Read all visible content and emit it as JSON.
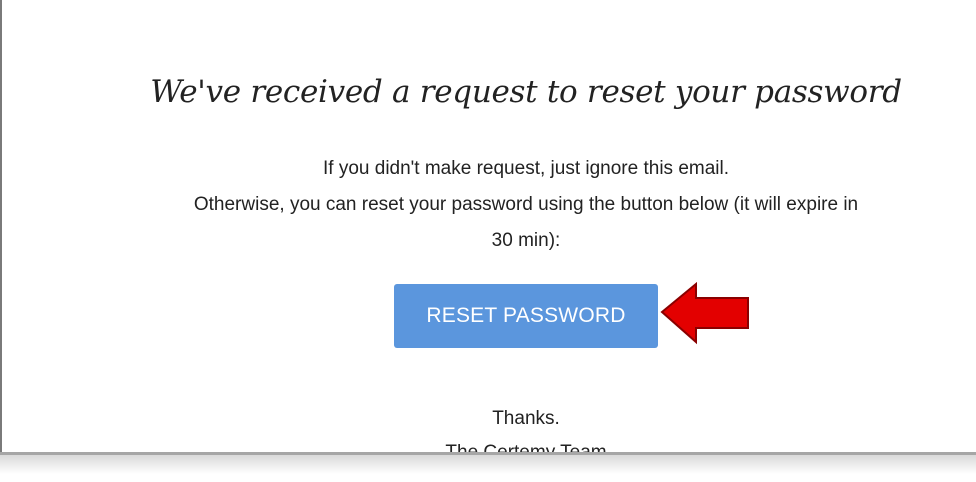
{
  "email": {
    "heading": "We've received a request to reset your password",
    "line1": "If you didn't make request, just ignore this email.",
    "line2": "Otherwise, you can reset your password using the button below (it will expire in",
    "line3": "30 min):",
    "button_label": "RESET PASSWORD",
    "signoff": "Thanks.",
    "signature": "The Certemy Team"
  },
  "colors": {
    "button": "#5b96dd",
    "arrow": "#e30000"
  },
  "icons": {
    "annotation": "left-arrow-icon"
  }
}
